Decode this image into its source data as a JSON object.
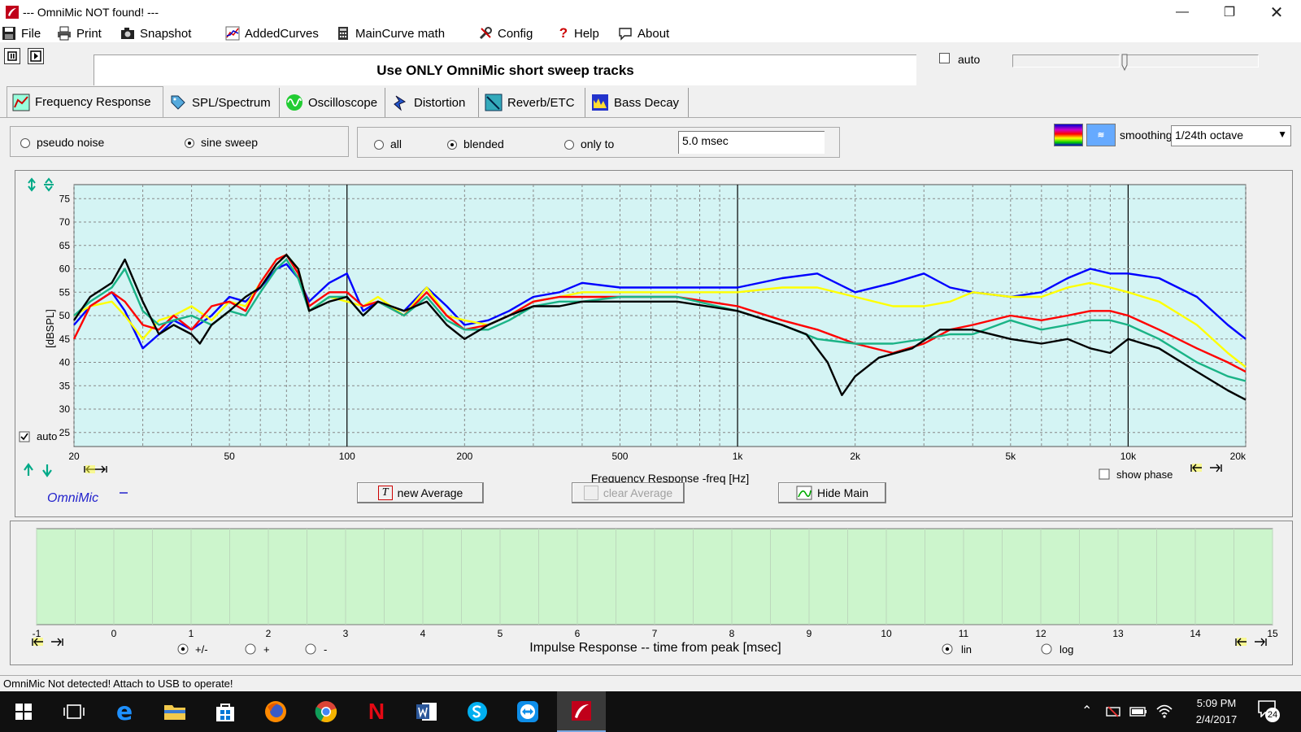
{
  "window": {
    "title": "--- OmniMic NOT found! ---"
  },
  "menu": [
    "File",
    "Print",
    "Snapshot",
    "AddedCurves",
    "MainCurve math",
    "Config",
    "Help",
    "About"
  ],
  "banner": "Use ONLY OmniMic short sweep tracks",
  "auto_label": "auto",
  "tabs": [
    "Frequency Response",
    "SPL/Spectrum",
    "Oscilloscope",
    "Distortion",
    "Reverb/ETC",
    "Bass Decay"
  ],
  "signal": {
    "pseudo_noise": "pseudo noise",
    "sine_sweep": "sine sweep",
    "selected": "sine sweep"
  },
  "window_mode": {
    "all": "all",
    "blended": "blended",
    "only_to": "only to",
    "time": "5.0 msec",
    "selected": "blended"
  },
  "smoothing": {
    "label": "smoothing",
    "value": "1/24th octave"
  },
  "freq_panel": {
    "auto_label": "auto",
    "brand": "OmniMic",
    "show_phase": "show phase",
    "new_average": "new Average",
    "clear_average": "clear Average",
    "hide_main": "Hide Main"
  },
  "impulse_panel": {
    "xlabel": "Impulse Response  -- time from peak [msec]",
    "ticks": [
      "-1",
      "0",
      "1",
      "2",
      "3",
      "4",
      "5",
      "6",
      "7",
      "8",
      "9",
      "10",
      "11",
      "12",
      "13",
      "14",
      "15"
    ],
    "polarity": {
      "both": "+/-",
      "plus": "+",
      "minus": "-",
      "selected": "+/-"
    },
    "scale": {
      "lin": "lin",
      "log": "log",
      "selected": "lin"
    }
  },
  "status": "OmniMic Not detected! Attach to USB to operate!",
  "taskbar": {
    "time": "5:09 PM",
    "date": "2/4/2017",
    "notifications": "24"
  },
  "colors": {
    "plot_bg": "#d4f4f4",
    "impulse_bg": "#ccf5cc",
    "accent": "#0000ff"
  },
  "chart_data": {
    "type": "line",
    "xlabel": "Frequency Response -freq [Hz]",
    "ylabel": "[dBSPL]",
    "xscale": "log",
    "xlim": [
      20,
      20000
    ],
    "ylim": [
      22,
      78
    ],
    "xticks": [
      {
        "v": 20,
        "t": "20"
      },
      {
        "v": 50,
        "t": "50"
      },
      {
        "v": 100,
        "t": "100"
      },
      {
        "v": 200,
        "t": "200"
      },
      {
        "v": 500,
        "t": "500"
      },
      {
        "v": 1000,
        "t": "1k"
      },
      {
        "v": 2000,
        "t": "2k"
      },
      {
        "v": 5000,
        "t": "5k"
      },
      {
        "v": 10000,
        "t": "10k"
      },
      {
        "v": 20000,
        "t": "20k"
      }
    ],
    "yticks": [
      25,
      30,
      35,
      40,
      45,
      50,
      55,
      60,
      65,
      70,
      75
    ],
    "grid": true,
    "series": [
      {
        "color": "#0000ff",
        "points": [
          [
            20,
            48
          ],
          [
            22,
            52
          ],
          [
            25,
            55
          ],
          [
            27,
            51
          ],
          [
            30,
            43
          ],
          [
            33,
            46
          ],
          [
            36,
            49
          ],
          [
            40,
            47
          ],
          [
            45,
            50
          ],
          [
            50,
            54
          ],
          [
            55,
            53
          ],
          [
            60,
            56
          ],
          [
            66,
            60
          ],
          [
            70,
            61
          ],
          [
            75,
            58
          ],
          [
            80,
            53
          ],
          [
            90,
            57
          ],
          [
            100,
            59
          ],
          [
            110,
            51
          ],
          [
            120,
            53
          ],
          [
            140,
            51
          ],
          [
            160,
            56
          ],
          [
            180,
            52
          ],
          [
            200,
            48
          ],
          [
            230,
            49
          ],
          [
            260,
            51
          ],
          [
            300,
            54
          ],
          [
            350,
            55
          ],
          [
            400,
            57
          ],
          [
            500,
            56
          ],
          [
            700,
            56
          ],
          [
            1000,
            56
          ],
          [
            1300,
            58
          ],
          [
            1600,
            59
          ],
          [
            2000,
            55
          ],
          [
            2500,
            57
          ],
          [
            3000,
            59
          ],
          [
            3500,
            56
          ],
          [
            4000,
            55
          ],
          [
            5000,
            54
          ],
          [
            6000,
            55
          ],
          [
            7000,
            58
          ],
          [
            8000,
            60
          ],
          [
            9000,
            59
          ],
          [
            10000,
            59
          ],
          [
            12000,
            58
          ],
          [
            15000,
            54
          ],
          [
            18000,
            48
          ],
          [
            20000,
            45
          ]
        ]
      },
      {
        "color": "#ffff00",
        "points": [
          [
            20,
            50
          ],
          [
            22,
            52
          ],
          [
            25,
            53
          ],
          [
            27,
            50
          ],
          [
            30,
            45
          ],
          [
            33,
            49
          ],
          [
            36,
            50
          ],
          [
            40,
            52
          ],
          [
            45,
            49
          ],
          [
            50,
            53
          ],
          [
            55,
            52
          ],
          [
            60,
            57
          ],
          [
            66,
            62
          ],
          [
            70,
            63
          ],
          [
            75,
            60
          ],
          [
            80,
            51
          ],
          [
            90,
            54
          ],
          [
            100,
            53
          ],
          [
            110,
            52
          ],
          [
            120,
            54
          ],
          [
            140,
            50
          ],
          [
            160,
            56
          ],
          [
            180,
            50
          ],
          [
            200,
            49
          ],
          [
            230,
            48
          ],
          [
            260,
            50
          ],
          [
            300,
            53
          ],
          [
            350,
            54
          ],
          [
            400,
            55
          ],
          [
            500,
            55
          ],
          [
            700,
            55
          ],
          [
            1000,
            55
          ],
          [
            1300,
            56
          ],
          [
            1600,
            56
          ],
          [
            2000,
            54
          ],
          [
            2500,
            52
          ],
          [
            3000,
            52
          ],
          [
            3500,
            53
          ],
          [
            4000,
            55
          ],
          [
            5000,
            54
          ],
          [
            6000,
            54
          ],
          [
            7000,
            56
          ],
          [
            8000,
            57
          ],
          [
            9000,
            56
          ],
          [
            10000,
            55
          ],
          [
            12000,
            53
          ],
          [
            15000,
            48
          ],
          [
            18000,
            42
          ],
          [
            20000,
            39
          ]
        ]
      },
      {
        "color": "#ff0000",
        "points": [
          [
            20,
            45
          ],
          [
            22,
            52
          ],
          [
            25,
            55
          ],
          [
            27,
            53
          ],
          [
            30,
            48
          ],
          [
            33,
            47
          ],
          [
            36,
            50
          ],
          [
            40,
            47
          ],
          [
            45,
            52
          ],
          [
            50,
            53
          ],
          [
            55,
            51
          ],
          [
            60,
            57
          ],
          [
            66,
            62
          ],
          [
            70,
            63
          ],
          [
            75,
            59
          ],
          [
            80,
            52
          ],
          [
            90,
            55
          ],
          [
            100,
            55
          ],
          [
            110,
            52
          ],
          [
            120,
            53
          ],
          [
            140,
            50
          ],
          [
            160,
            55
          ],
          [
            180,
            50
          ],
          [
            200,
            47
          ],
          [
            230,
            48
          ],
          [
            260,
            50
          ],
          [
            300,
            53
          ],
          [
            350,
            54
          ],
          [
            400,
            54
          ],
          [
            500,
            54
          ],
          [
            700,
            54
          ],
          [
            1000,
            52
          ],
          [
            1300,
            49
          ],
          [
            1600,
            47
          ],
          [
            2000,
            44
          ],
          [
            2500,
            42
          ],
          [
            3000,
            44
          ],
          [
            3500,
            47
          ],
          [
            4000,
            48
          ],
          [
            5000,
            50
          ],
          [
            6000,
            49
          ],
          [
            7000,
            50
          ],
          [
            8000,
            51
          ],
          [
            9000,
            51
          ],
          [
            10000,
            50
          ],
          [
            12000,
            47
          ],
          [
            15000,
            43
          ],
          [
            18000,
            40
          ],
          [
            20000,
            38
          ]
        ]
      },
      {
        "color": "#1ab386",
        "points": [
          [
            20,
            50
          ],
          [
            22,
            53
          ],
          [
            25,
            56
          ],
          [
            27,
            60
          ],
          [
            30,
            51
          ],
          [
            33,
            48
          ],
          [
            36,
            49
          ],
          [
            40,
            50
          ],
          [
            45,
            48
          ],
          [
            50,
            51
          ],
          [
            55,
            50
          ],
          [
            60,
            55
          ],
          [
            66,
            60
          ],
          [
            70,
            62
          ],
          [
            75,
            58
          ],
          [
            80,
            51
          ],
          [
            90,
            54
          ],
          [
            100,
            54
          ],
          [
            110,
            50
          ],
          [
            120,
            53
          ],
          [
            140,
            50
          ],
          [
            160,
            54
          ],
          [
            180,
            49
          ],
          [
            200,
            47
          ],
          [
            230,
            47
          ],
          [
            260,
            49
          ],
          [
            300,
            52
          ],
          [
            350,
            53
          ],
          [
            400,
            53
          ],
          [
            500,
            54
          ],
          [
            700,
            54
          ],
          [
            1000,
            51
          ],
          [
            1300,
            48
          ],
          [
            1600,
            45
          ],
          [
            2000,
            44
          ],
          [
            2500,
            44
          ],
          [
            3000,
            45
          ],
          [
            3500,
            46
          ],
          [
            4000,
            46
          ],
          [
            5000,
            49
          ],
          [
            6000,
            47
          ],
          [
            7000,
            48
          ],
          [
            8000,
            49
          ],
          [
            9000,
            49
          ],
          [
            10000,
            48
          ],
          [
            12000,
            45
          ],
          [
            15000,
            40
          ],
          [
            18000,
            37
          ],
          [
            20000,
            36
          ]
        ]
      },
      {
        "color": "#000000",
        "points": [
          [
            20,
            49
          ],
          [
            22,
            54
          ],
          [
            25,
            57
          ],
          [
            27,
            62
          ],
          [
            30,
            53
          ],
          [
            33,
            46
          ],
          [
            36,
            48
          ],
          [
            40,
            46
          ],
          [
            42,
            44
          ],
          [
            45,
            48
          ],
          [
            50,
            51
          ],
          [
            55,
            54
          ],
          [
            60,
            56
          ],
          [
            66,
            61
          ],
          [
            70,
            63
          ],
          [
            75,
            60
          ],
          [
            80,
            51
          ],
          [
            90,
            53
          ],
          [
            100,
            54
          ],
          [
            110,
            50
          ],
          [
            120,
            53
          ],
          [
            140,
            51
          ],
          [
            160,
            53
          ],
          [
            180,
            48
          ],
          [
            200,
            45
          ],
          [
            230,
            48
          ],
          [
            260,
            50
          ],
          [
            300,
            52
          ],
          [
            350,
            52
          ],
          [
            400,
            53
          ],
          [
            500,
            53
          ],
          [
            700,
            53
          ],
          [
            1000,
            51
          ],
          [
            1300,
            48
          ],
          [
            1500,
            46
          ],
          [
            1700,
            40
          ],
          [
            1850,
            33
          ],
          [
            2000,
            37
          ],
          [
            2300,
            41
          ],
          [
            2800,
            43
          ],
          [
            3300,
            47
          ],
          [
            4000,
            47
          ],
          [
            5000,
            45
          ],
          [
            6000,
            44
          ],
          [
            7000,
            45
          ],
          [
            8000,
            43
          ],
          [
            9000,
            42
          ],
          [
            10000,
            45
          ],
          [
            12000,
            43
          ],
          [
            15000,
            38
          ],
          [
            18000,
            34
          ],
          [
            20000,
            32
          ]
        ]
      }
    ]
  }
}
